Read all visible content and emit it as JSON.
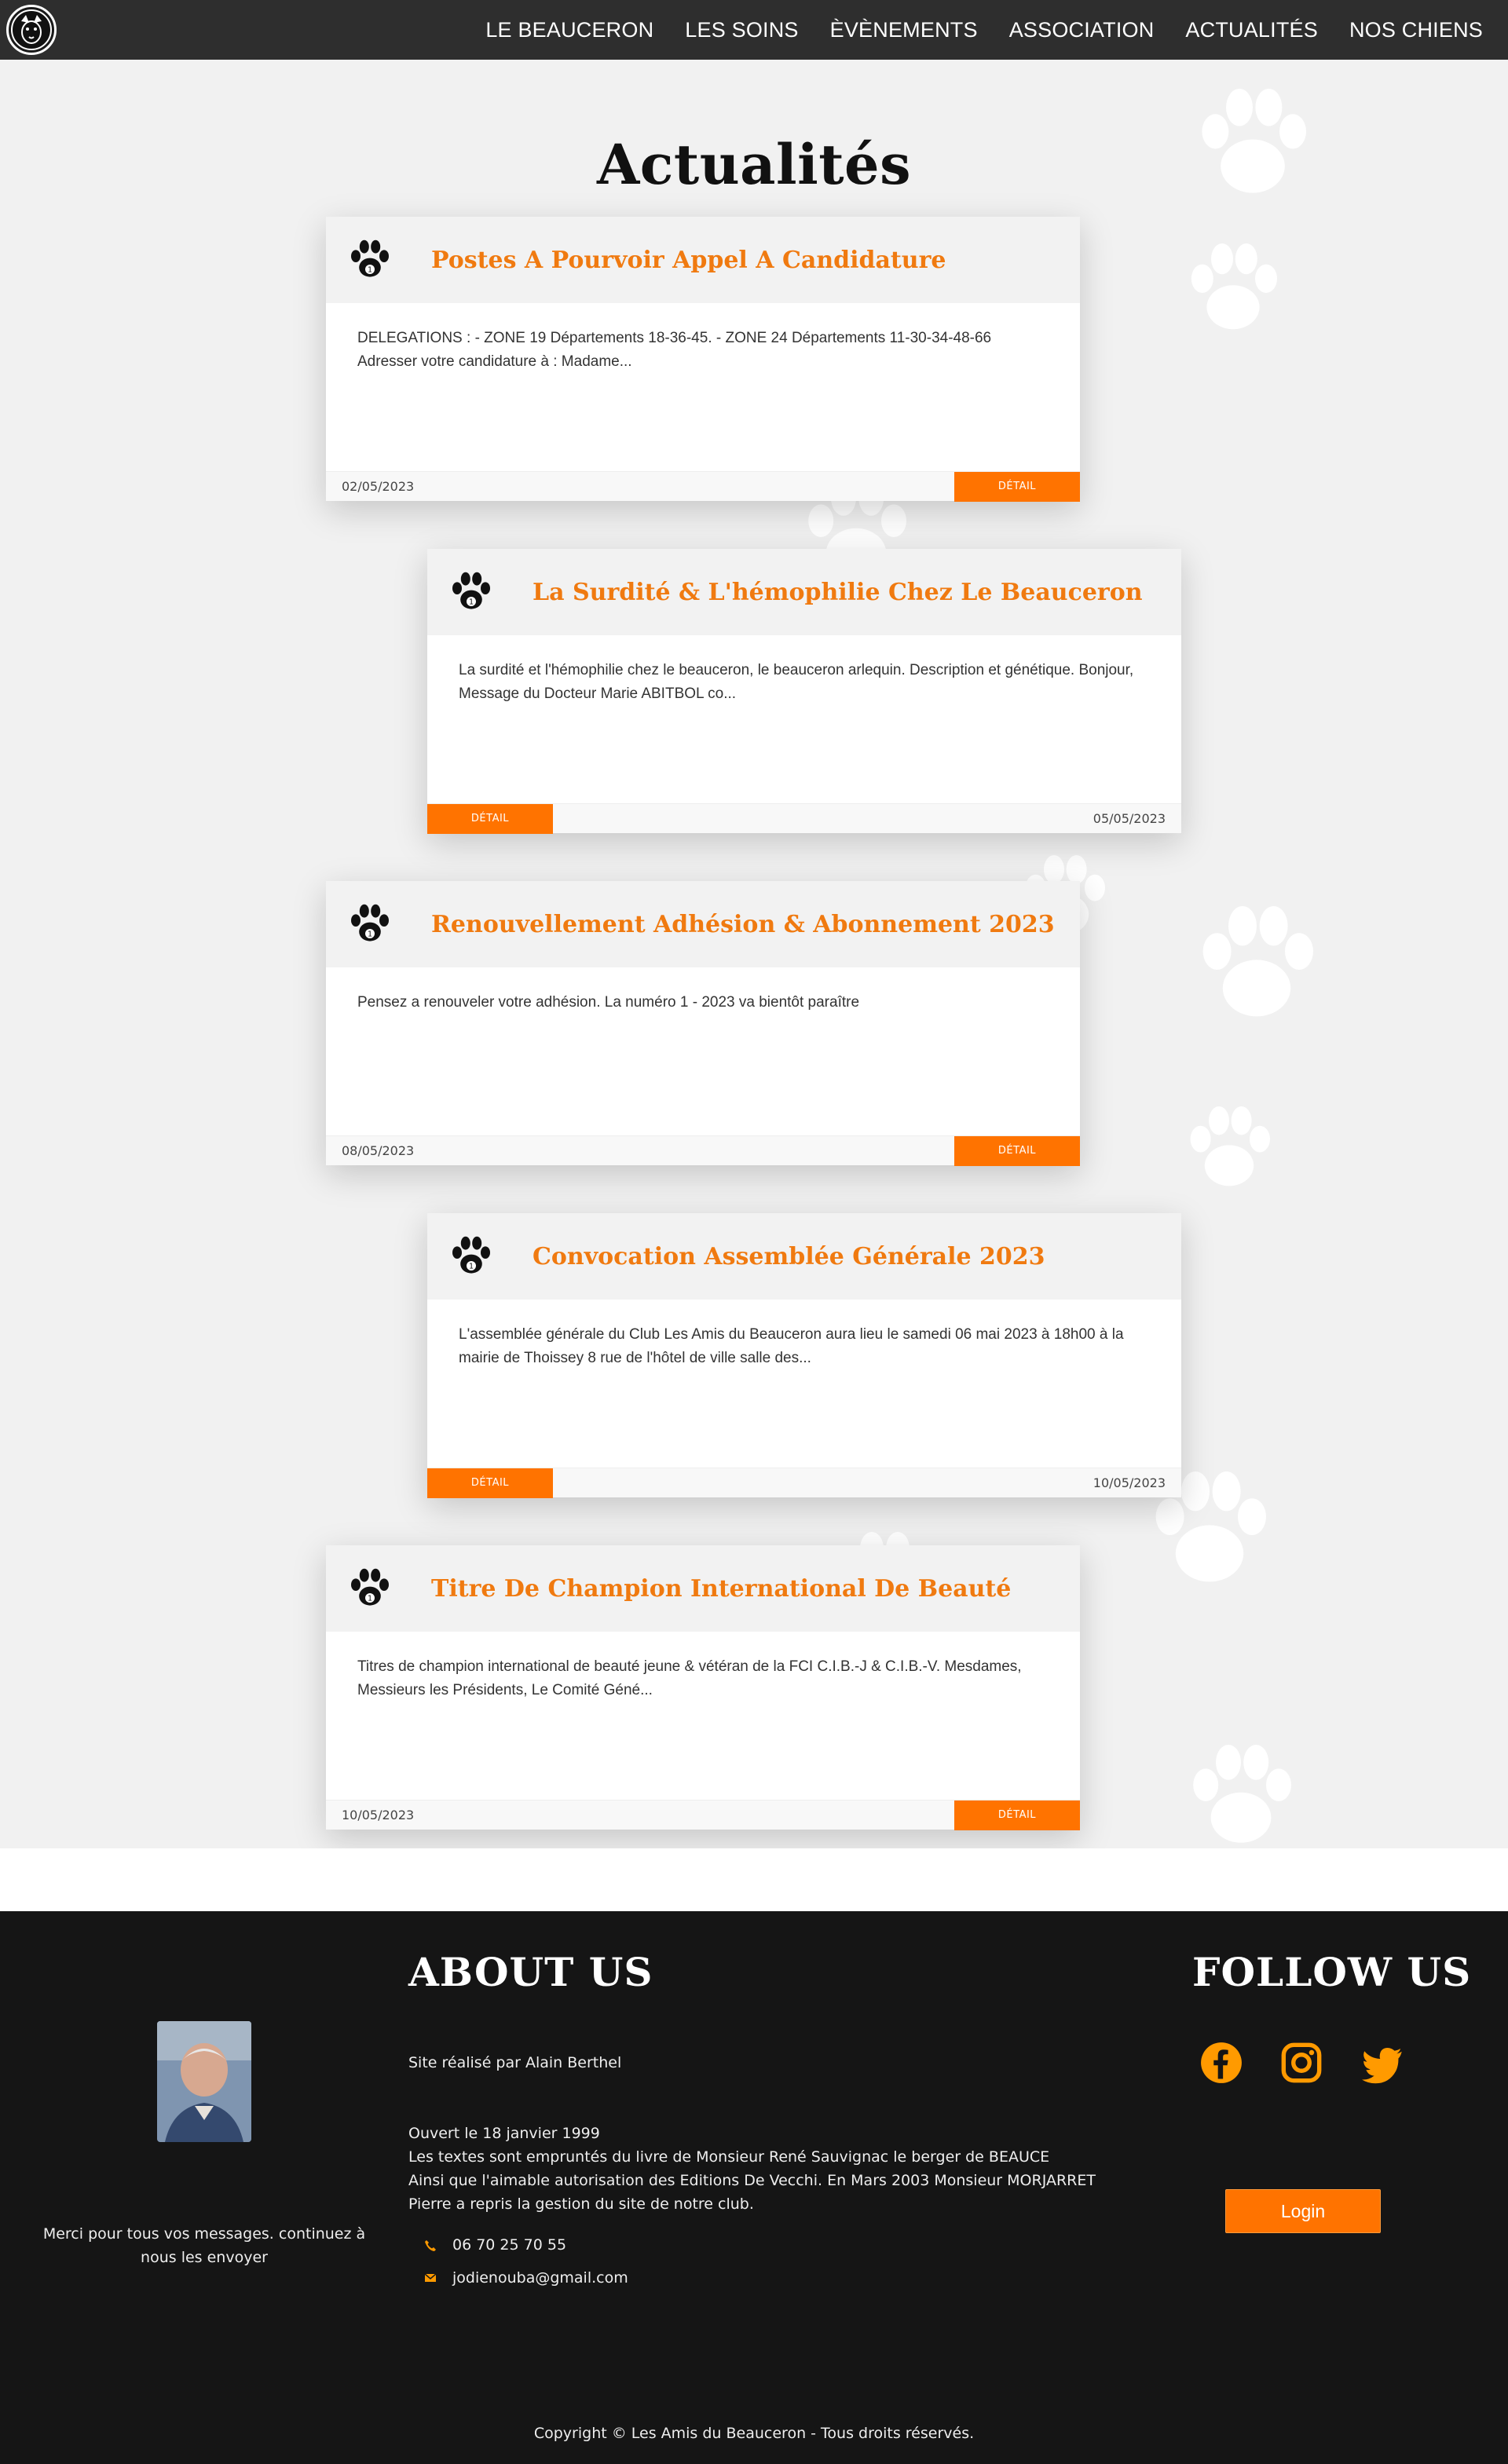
{
  "nav": {
    "logo_alt": "Les Amis du Beauceron",
    "items": [
      "LE BEAUCERON",
      "LES SOINS",
      "ÈVÈNEMENTS",
      "ASSOCIATION",
      "ACTUALITÉS",
      "NOS CHIENS"
    ]
  },
  "page": {
    "title": "Actualités"
  },
  "cards": [
    {
      "title": "Postes A Pourvoir Appel A Candidature",
      "excerpt": "DELEGATIONS : - ZONE 19 Départements 18-36-45. - ZONE 24 Départements 11-30-34-48-66 Adresser votre candidature à : Madame...",
      "date": "02/05/2023",
      "button": "DÉTAIL"
    },
    {
      "title": "La Surdité & L'hémophilie Chez Le Beauceron",
      "excerpt": "La surdité et l'hémophilie chez le beauceron, le beauceron arlequin. Description et génétique. Bonjour, Message du Docteur Marie ABITBOL co...",
      "date": "05/05/2023",
      "button": "DÉTAIL"
    },
    {
      "title": "Renouvellement Adhésion & Abonnement 2023",
      "excerpt": "Pensez a renouveler votre adhésion. La numéro 1 - 2023 va bientôt paraître",
      "date": "08/05/2023",
      "button": "DÉTAIL"
    },
    {
      "title": "Convocation Assemblée Générale 2023",
      "excerpt": "L'assemblée générale du Club Les Amis du Beauceron aura lieu le samedi 06 mai 2023 à 18h00 à la mairie de Thoissey 8 rue de l'hôtel de ville salle des...",
      "date": "10/05/2023",
      "button": "DÉTAIL"
    },
    {
      "title": "Titre De Champion International De Beauté",
      "excerpt": "Titres de champion international de beauté jeune & vétéran de la FCI C.I.B.-J & C.I.B.-V. Mesdames, Messieurs les Présidents, Le Comité Géné...",
      "date": "10/05/2023",
      "button": "DÉTAIL"
    }
  ],
  "footer": {
    "about_heading": "ABOUT US",
    "follow_heading": "FOLLOW US",
    "thanks": "Merci pour tous vos messages. continuez à nous les envoyer",
    "credit": "Site réalisé par Alain Berthel",
    "about_lines": [
      "Ouvert le 18 janvier 1999",
      "Les textes sont empruntés du livre de Monsieur René Sauvignac le berger de BEAUCE",
      "Ainsi que l'aimable autorisation des Editions De Vecchi. En Mars 2003 Monsieur MORJARRET",
      "Pierre a repris la gestion du site de notre club."
    ],
    "phone": "06 70 25 70 55",
    "email": "jodienouba@gmail.com",
    "login": "Login",
    "copyright": "Copyright © Les Amis du Beauceron - Tous droits réservés.",
    "social": [
      "facebook-icon",
      "instagram-icon",
      "twitter-icon"
    ],
    "accent_color": "#ff9a00"
  }
}
